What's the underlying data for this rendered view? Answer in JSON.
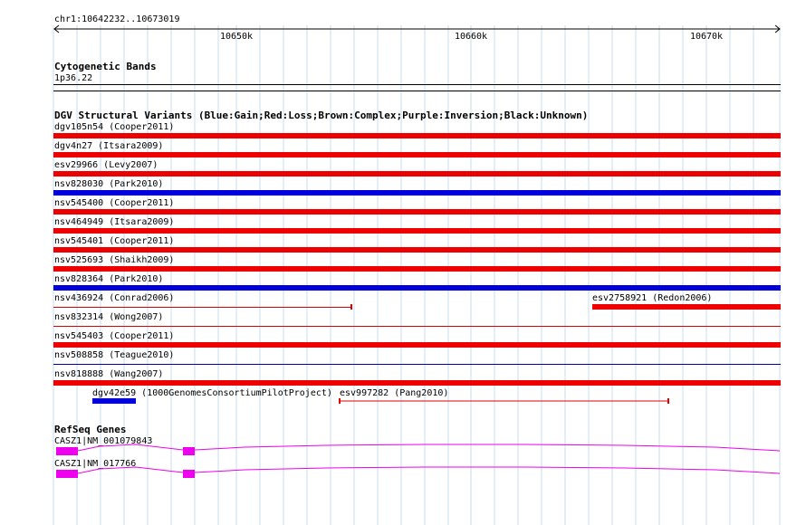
{
  "ruler": {
    "coords": "chr1:10642232..10673019",
    "ticks": [
      "10650k",
      "10660k",
      "10670k"
    ]
  },
  "cytoband": {
    "title": "Cytogenetic Bands",
    "band": "1p36.22"
  },
  "dgv": {
    "title": "DGV Structural Variants (Blue:Gain;Red:Loss;Brown:Complex;Purple:Inversion;Black:Unknown)",
    "colors": {
      "gain": "#0000dd",
      "loss": "#ee0000",
      "red_line": "#dd0000",
      "blue_line": "#0000aa"
    },
    "rows": [
      {
        "label": "dgv105n54 (Cooper2011)",
        "kind": "loss"
      },
      {
        "label": "dgv4n27 (Itsara2009)",
        "kind": "loss"
      },
      {
        "label": "esv29966 (Levy2007)",
        "kind": "loss"
      },
      {
        "label": "nsv828030 (Park2010)",
        "kind": "gain"
      },
      {
        "label": "nsv545400 (Cooper2011)",
        "kind": "loss"
      },
      {
        "label": "nsv464949 (Itsara2009)",
        "kind": "loss"
      },
      {
        "label": "nsv545401 (Cooper2011)",
        "kind": "loss"
      },
      {
        "label": "nsv525693 (Shaikh2009)",
        "kind": "loss"
      },
      {
        "label": "nsv828364 (Park2010)",
        "kind": "gain"
      },
      {
        "label": "nsv436924 (Conrad2006)",
        "kind": "loss_line",
        "extra_label": "esv2758921 (Redon2006)"
      },
      {
        "label": "nsv832314 (Wong2007)",
        "kind": "loss_line_full"
      },
      {
        "label": "nsv545403 (Cooper2011)",
        "kind": "loss"
      },
      {
        "label": "nsv508858 (Teague2010)",
        "kind": "gain_line_full"
      },
      {
        "label": "nsv818888 (Wang2007)",
        "kind": "loss"
      }
    ],
    "last_row": {
      "left_label": "dgv42e59 (1000GenomesConsortiumPilotProject)",
      "right_label": "esv997282 (Pang2010)"
    }
  },
  "refseq": {
    "title": "RefSeq Genes",
    "color": "#ee00ee",
    "genes": [
      {
        "label": "CASZ1|NM_001079843"
      },
      {
        "label": "CASZ1|NM_017766"
      }
    ]
  }
}
